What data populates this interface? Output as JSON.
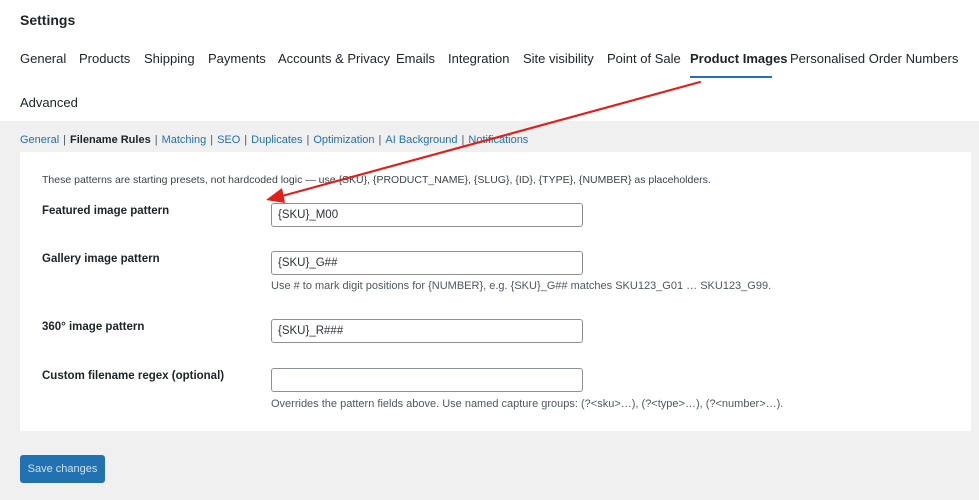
{
  "page_title": "Settings",
  "tabs": [
    {
      "label": "General"
    },
    {
      "label": "Products"
    },
    {
      "label": "Shipping"
    },
    {
      "label": "Payments"
    },
    {
      "label": "Accounts & Privacy"
    },
    {
      "label": "Emails"
    },
    {
      "label": "Integration"
    },
    {
      "label": "Site visibility"
    },
    {
      "label": "Point of Sale"
    },
    {
      "label": "Product Images",
      "active": true
    },
    {
      "label": "Personalised Order Numbers"
    },
    {
      "label": "Advanced"
    }
  ],
  "subnav": {
    "separator": "|",
    "items": [
      {
        "label": "General"
      },
      {
        "label": "Filename Rules",
        "current": true
      },
      {
        "label": "Matching"
      },
      {
        "label": "SEO"
      },
      {
        "label": "Duplicates"
      },
      {
        "label": "Optimization"
      },
      {
        "label": "AI Background"
      },
      {
        "label": "Notifications"
      }
    ]
  },
  "intro_text": "These patterns are starting presets, not hardcoded logic — use {SKU}, {PRODUCT_NAME}, {SLUG}, {ID}, {TYPE}, {NUMBER} as placeholders.",
  "fields": {
    "featured": {
      "label": "Featured image pattern",
      "value": "{SKU}_M00"
    },
    "gallery": {
      "label": "Gallery image pattern",
      "value": "{SKU}_G##",
      "help": "Use # to mark digit positions for {NUMBER}, e.g. {SKU}_G## matches SKU123_G01 … SKU123_G99."
    },
    "three_sixty": {
      "label": "360° image pattern",
      "value": "{SKU}_R###"
    },
    "regex": {
      "label": "Custom filename regex (optional)",
      "value": "",
      "help": "Overrides the pattern fields above. Use named capture groups: (?<sku>…), (?<type>…), (?<number>…)."
    }
  },
  "save_button": "Save changes",
  "colors": {
    "accent": "#2271b1",
    "annotation_arrow": "#e0201b"
  }
}
